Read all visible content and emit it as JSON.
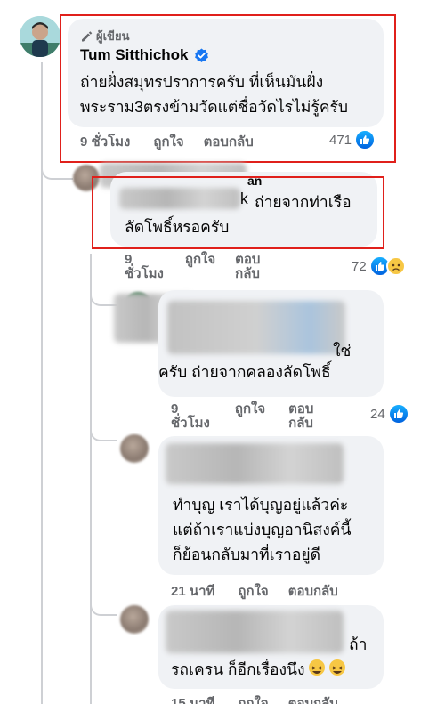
{
  "top_partial": {
    "dot": "·"
  },
  "comment_main": {
    "author_badge": "ผู้เขียน",
    "name": "Tum Sitthichok",
    "lines": [
      "ถ่ายฝั่งสมุทรปราการครับ ที่เห็นมันฝั่ง",
      "พระราม3ตรงข้ามวัดแต่ชื่อวัดไรไม่รู้ครับ"
    ],
    "time": "9 ชั่วโมง",
    "like": "ถูกใจ",
    "reply": "ตอบกลับ",
    "reactions": "471"
  },
  "comment_reply1": {
    "name_fragment": "an",
    "text_fragment": "k",
    "lines": [
      "ถ่ายจากท่าเรือ",
      "ลัดโพธิ์หรอครับ"
    ],
    "time_l1": "9",
    "time_l2": "ชั่วโมง",
    "like": "ถูกใจ",
    "reply_l1": "ตอบ",
    "reply_l2": "กลับ",
    "reactions": "72"
  },
  "comment_reply2": {
    "line1_end": "ใช่",
    "line2": "ครับ ถ่ายจากคลองลัดโพธิ์",
    "time_l1": "9",
    "time_l2": "ชั่วโมง",
    "like": "ถูกใจ",
    "reply_l1": "ตอบ",
    "reply_l2": "กลับ",
    "reactions": "24"
  },
  "comment_reply3": {
    "lines": [
      "ทำบุญ เราได้บุญอยู่แล้วค่ะ",
      "แต่ถ้าเราแบ่งบุญอานิสงค์นี้",
      "ก็ย้อนกลับมาที่เราอยู่ดี"
    ],
    "time": "21 นาที",
    "like": "ถูกใจ",
    "reply": "ตอบกลับ"
  },
  "comment_reply4": {
    "line1_end": "ถ้า",
    "line2": "รถเครน ก็อีกเรื่องนึง",
    "time": "15 นาที",
    "like": "ถูกใจ",
    "reply": "ตอบกลับ"
  },
  "colors": {
    "highlight": "#e0201b",
    "like_blue": "#1877f2",
    "bubble": "#f0f2f5",
    "meta": "#65676b"
  }
}
